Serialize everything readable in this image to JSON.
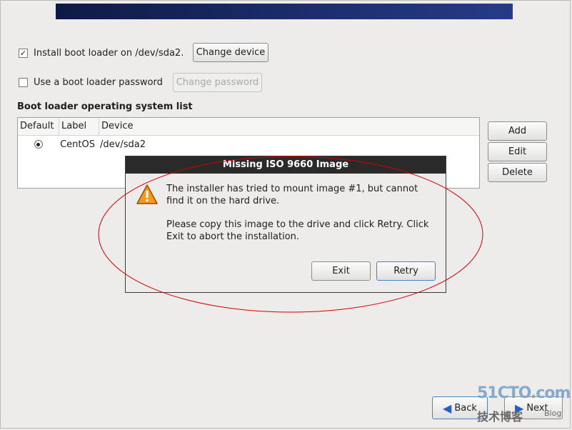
{
  "bootloader": {
    "install_label": "Install boot loader on /dev/sda2.",
    "install_checked": true,
    "change_device_label": "Change device",
    "password_label": "Use a boot loader password",
    "password_checked": false,
    "change_password_label": "Change password"
  },
  "os_list": {
    "heading": "Boot loader operating system list",
    "columns": [
      "Default",
      "Label",
      "Device"
    ],
    "rows": [
      {
        "label": "CentOS",
        "device": "/dev/sda2",
        "default": true
      }
    ],
    "buttons": {
      "add": "Add",
      "edit": "Edit",
      "delete": "Delete"
    }
  },
  "dialog": {
    "title": "Missing ISO 9660 Image",
    "message1": "The installer has tried to mount image #1, but cannot find it on the hard drive.",
    "message2": "Please copy this image to the drive and click Retry.  Click Exit to abort the installation.",
    "exit_label": "Exit",
    "retry_label": "Retry"
  },
  "nav": {
    "back_label": "Back",
    "next_label": "Next"
  },
  "watermark": {
    "line1": "51CTO.com",
    "line2": "技术博客",
    "line3": "Blog"
  },
  "colors": {
    "annotation_ellipse": "#d40000",
    "banner": "#1d2f6e",
    "warning": "#f29b1d"
  }
}
